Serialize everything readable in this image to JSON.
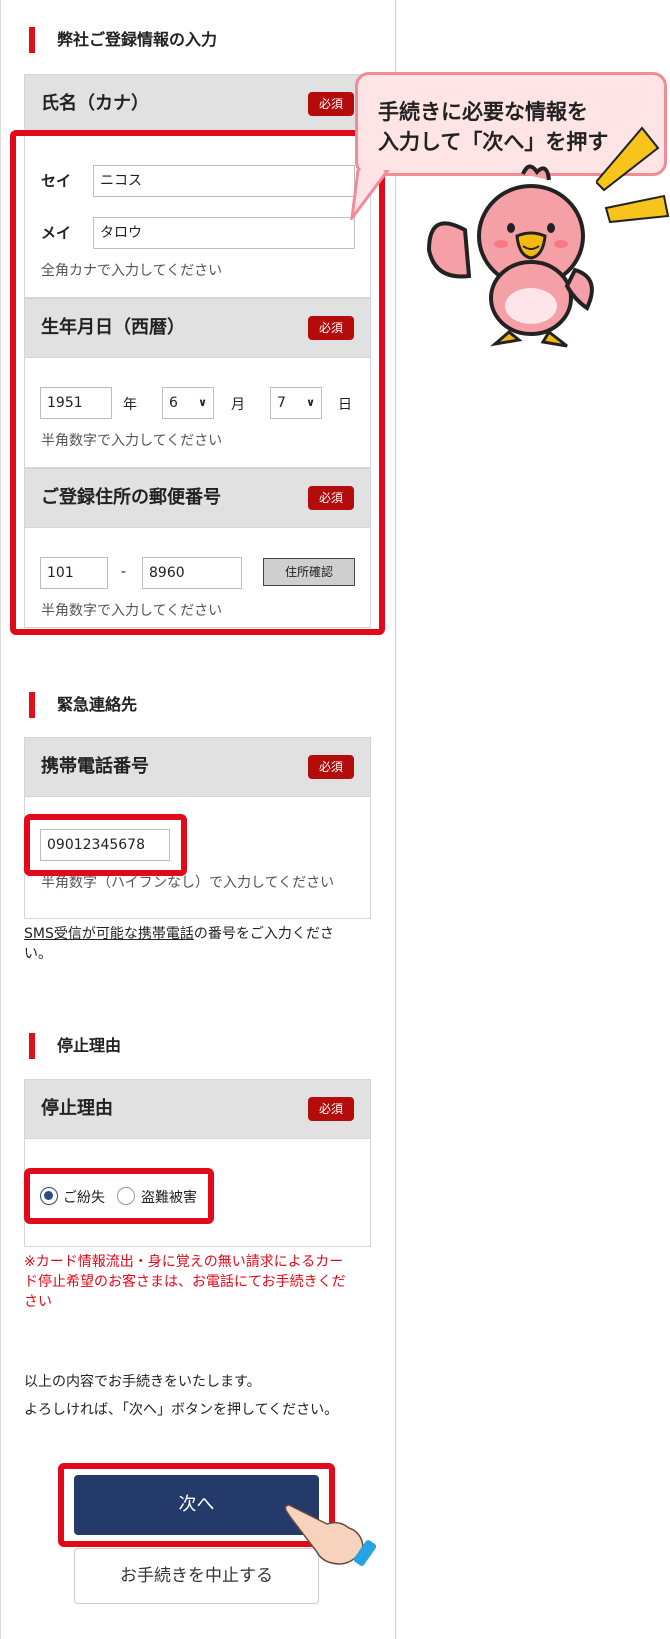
{
  "sections": {
    "registration_title": "弊社ご登録情報の入力",
    "emergency_title": "緊急連絡先",
    "reason_title": "停止理由"
  },
  "required_badge": "必須",
  "name": {
    "label": "氏名（カナ）",
    "sei_label": "セイ",
    "sei_value": "ニコス",
    "mei_label": "メイ",
    "mei_value": "タロウ",
    "hint": "全角カナで入力してください"
  },
  "birth": {
    "label": "生年月日（西暦）",
    "year_value": "1951",
    "year_unit": "年",
    "month_value": "6",
    "month_unit": "月",
    "day_value": "7",
    "day_unit": "日",
    "hint": "半角数字で入力してください"
  },
  "postal": {
    "label": "ご登録住所の郵便番号",
    "first_value": "101",
    "dash": "-",
    "second_value": "8960",
    "confirm_button": "住所確認",
    "hint": "半角数字で入力してください"
  },
  "phone": {
    "label": "携帯電話番号",
    "value": "09012345678",
    "hint": "半角数字（ハイフンなし）で入力してください",
    "sms_link": "SMS受信が可能な携帯電話",
    "sms_note_line1": "の番号をご入力くださ",
    "sms_note_line2": "い。"
  },
  "reason": {
    "label": "停止理由",
    "option_lost": "ご紛失",
    "option_theft": "盗難被害",
    "selected": "ご紛失",
    "warning_line1": "※カード情報流出・身に覚えの無い請求によるカー",
    "warning_line2": "ド停止希望のお客さまは、お電話にてお手続きくだ",
    "warning_line3": "さい"
  },
  "confirm_text_line1": "以上の内容でお手続きをいたします。",
  "confirm_text_line2": "よろしければ、「次へ」ボタンを押してください。",
  "buttons": {
    "next": "次へ",
    "cancel": "お手続きを中止する"
  },
  "callout": {
    "line1": "手続きに必要な情報を",
    "line2": "入力して「次へ」を押す"
  },
  "colors": {
    "accent_red": "#e3091a",
    "required_red": "#b40b0b",
    "next_navy": "#243a6a",
    "radio_blue": "#2b4a84"
  }
}
